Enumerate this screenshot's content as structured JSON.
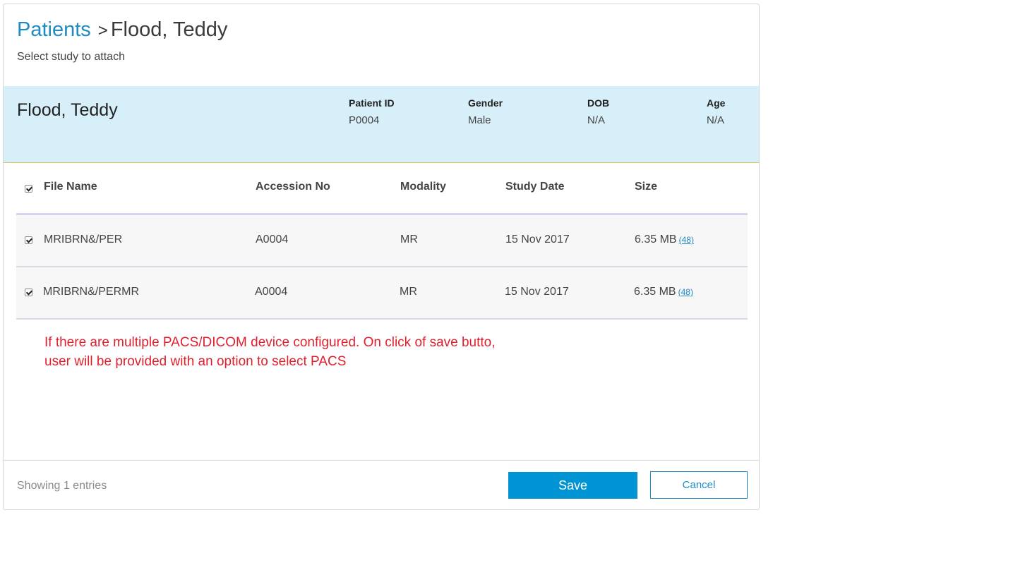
{
  "header": {
    "breadcrumb_root": "Patients",
    "breadcrumb_separator": ">",
    "breadcrumb_current": "Flood, Teddy",
    "subtitle": "Select study to attach"
  },
  "patient": {
    "name": "Flood, Teddy",
    "fields": [
      {
        "label": "Patient ID",
        "value": "P0004"
      },
      {
        "label": "Gender",
        "value": "Male"
      },
      {
        "label": "DOB",
        "value": "N/A"
      },
      {
        "label": "Age",
        "value": "N/A"
      }
    ]
  },
  "table": {
    "select_all_checked": true,
    "columns": [
      "File Name",
      "Accession No",
      "Modality",
      "Study Date",
      "Size"
    ],
    "rows": [
      {
        "checked": true,
        "file_name": "MRIBRN&/PER",
        "accession": "A0004",
        "modality": "MR",
        "study_date": "15 Nov 2017",
        "size": "6.35 MB",
        "count_link": "(48)"
      },
      {
        "checked": true,
        "file_name": "MRIBRN&/PERMR",
        "accession": "A0004",
        "modality": "MR",
        "study_date": "15 Nov 2017",
        "size": "6.35 MB",
        "count_link": "(48)"
      }
    ]
  },
  "note": "If there are multiple PACS/DICOM device configured. On click of save butto, user will be provided with an option to select PACS",
  "footer": {
    "entries_text": "Showing 1 entries",
    "save_label": "Save",
    "cancel_label": "Cancel"
  },
  "colors": {
    "accent": "#1e8bc3",
    "primary_button": "#0094d4",
    "banner_background": "#d6eff8",
    "note_text": "#e0202e"
  }
}
